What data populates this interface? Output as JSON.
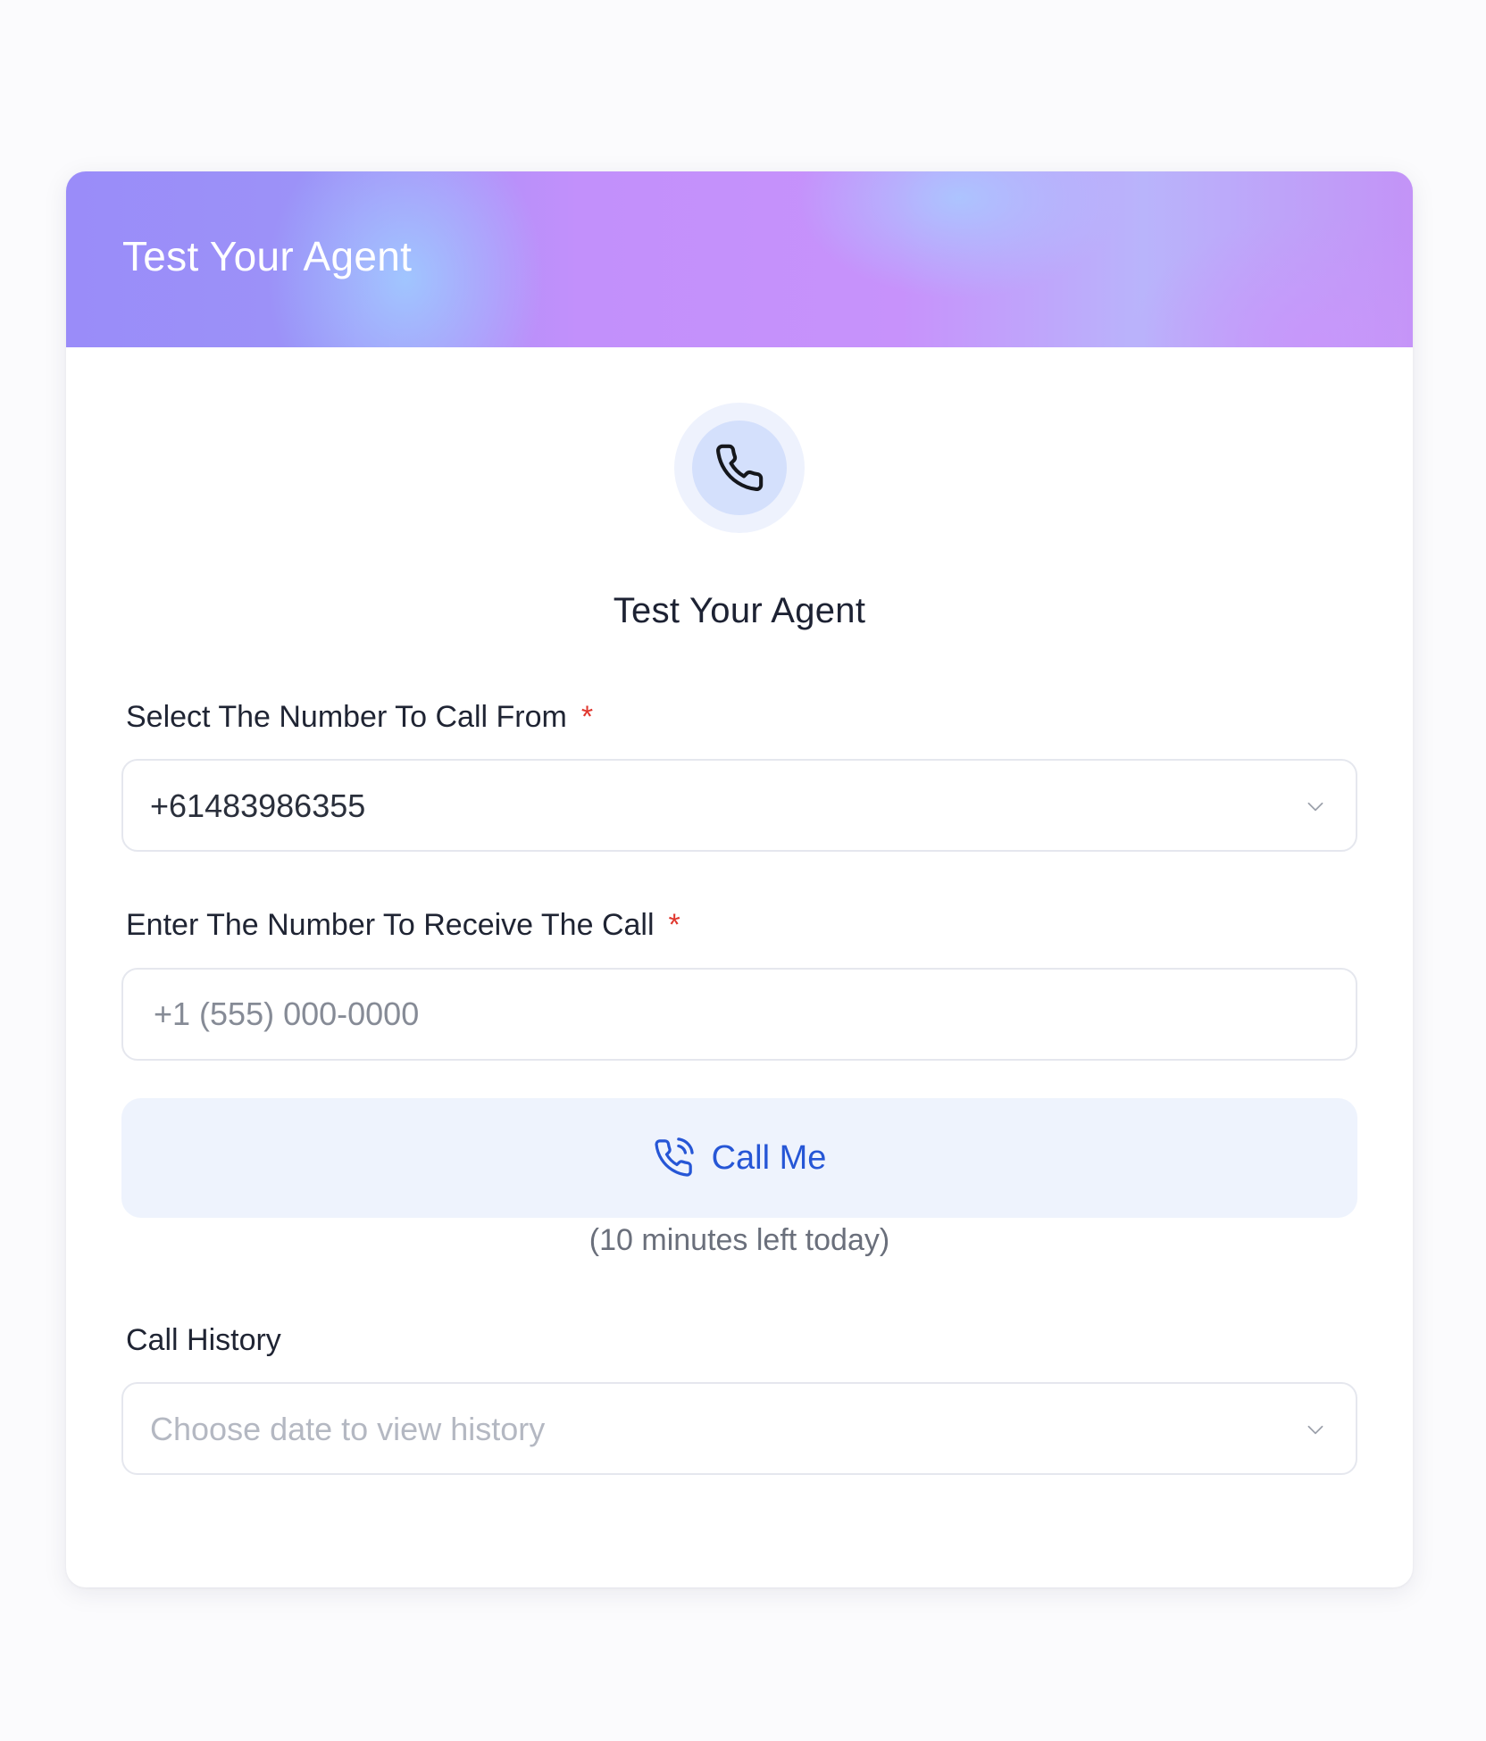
{
  "header": {
    "title": "Test Your Agent"
  },
  "main": {
    "icon": "phone-icon",
    "title": "Test Your Agent"
  },
  "from_number": {
    "label": "Select The Number To Call From",
    "required_mark": "*",
    "selected_value": "+61483986355"
  },
  "to_number": {
    "label": "Enter The Number To Receive The Call",
    "required_mark": "*",
    "value": "",
    "placeholder": "+1 (555) 000-0000"
  },
  "call_button": {
    "label": "Call Me",
    "icon": "phone-calling-icon"
  },
  "minutes_left": "(10 minutes left today)",
  "call_history": {
    "label": "Call History",
    "placeholder": "Choose date to view history"
  },
  "colors": {
    "accent": "#2656d6",
    "required": "#e0372e",
    "button_bg": "#eef3fd",
    "icon_circle": "#d4e0fc"
  }
}
